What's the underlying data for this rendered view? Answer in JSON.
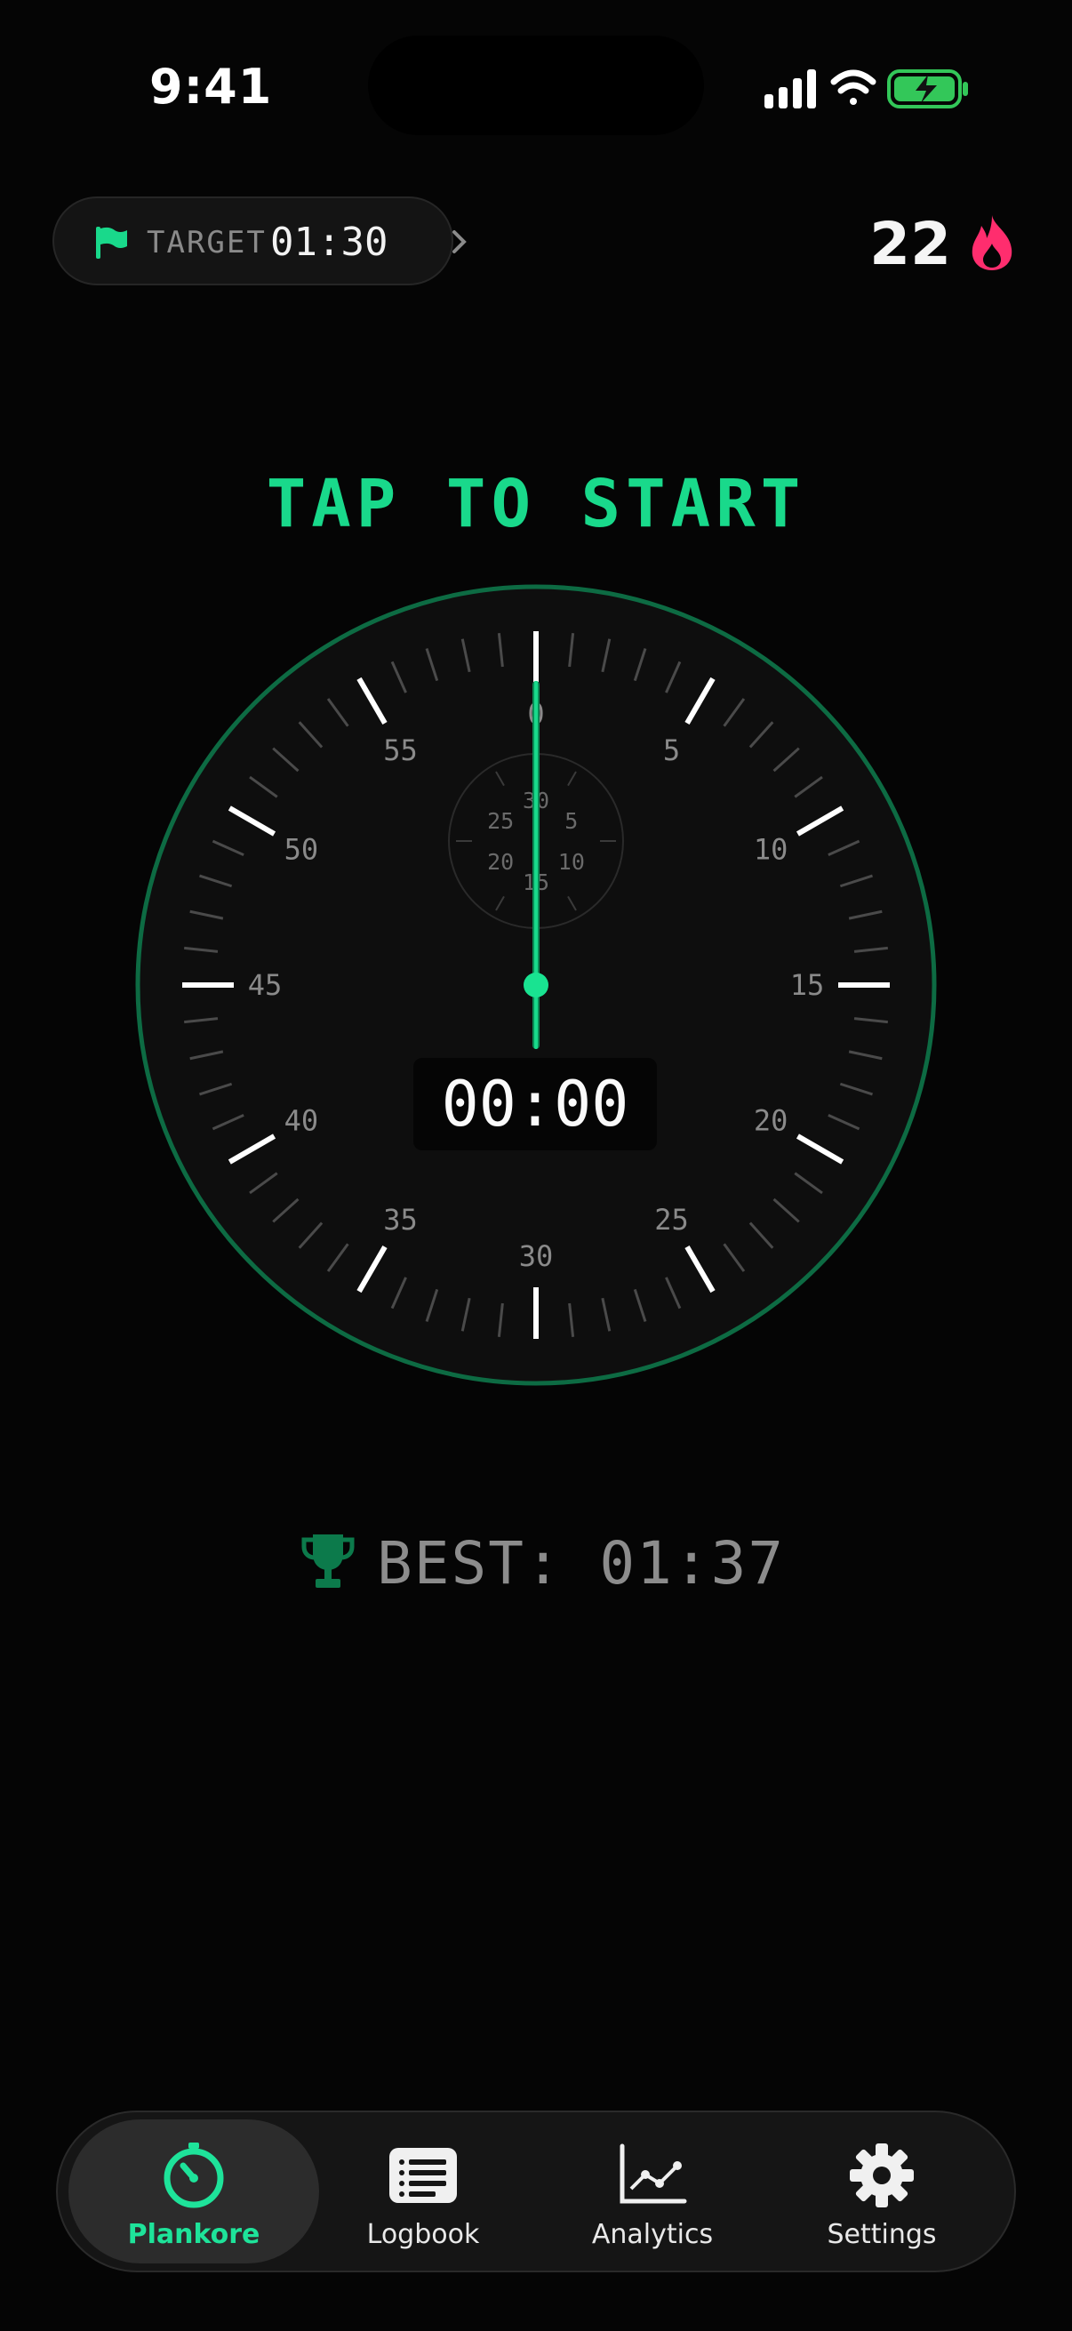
{
  "status": {
    "time": "9:41"
  },
  "target": {
    "label": "TARGET",
    "value": "01:30"
  },
  "streak": {
    "count": "22"
  },
  "headline": "TAP TO START",
  "dial": {
    "major_labels": [
      "0",
      "5",
      "10",
      "15",
      "20",
      "25",
      "30",
      "35",
      "40",
      "45",
      "50",
      "55"
    ],
    "sub_labels": [
      "30",
      "5",
      "10",
      "15",
      "20",
      "25"
    ]
  },
  "timer": {
    "display": "00:00"
  },
  "best": {
    "text": "BEST: 01:37"
  },
  "tabs": [
    {
      "label": "Plankore",
      "icon": "stopwatch-icon",
      "active": true
    },
    {
      "label": "Logbook",
      "icon": "list-icon",
      "active": false
    },
    {
      "label": "Analytics",
      "icon": "chart-icon",
      "active": false
    },
    {
      "label": "Settings",
      "icon": "gear-icon",
      "active": false
    }
  ],
  "colors": {
    "accent": "#19d98b",
    "flame": "#ff2d6e",
    "background": "#050505"
  }
}
